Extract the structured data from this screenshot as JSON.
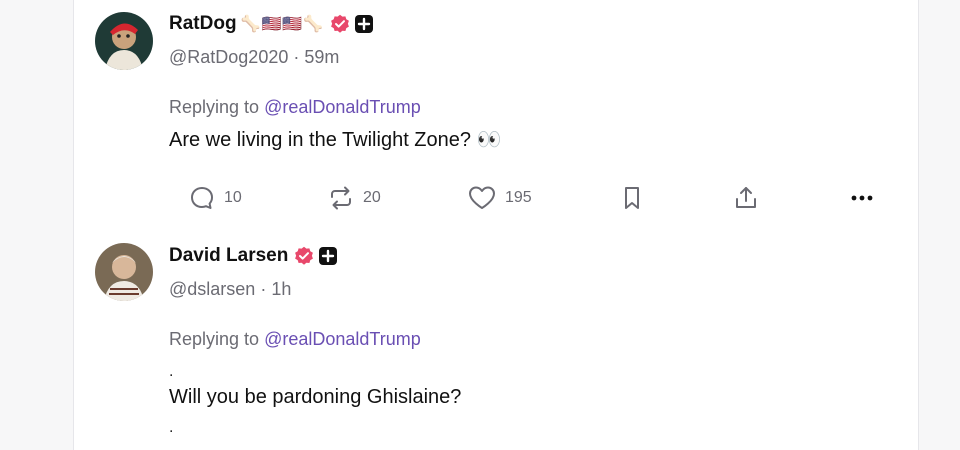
{
  "posts": [
    {
      "display_name": "RatDog",
      "name_emojis": "🦴🇺🇸🇺🇸🦴",
      "handle": "@RatDog2020",
      "time": "59m",
      "replying_prefix": "Replying to",
      "replying_mention": "@realDonaldTrump",
      "text": "Are we living in the Twilight Zone? 👀",
      "actions": {
        "replies": "10",
        "reposts": "20",
        "likes": "195"
      }
    },
    {
      "display_name": "David Larsen",
      "handle": "@dslarsen",
      "time": "1h",
      "replying_prefix": "Replying to",
      "replying_mention": "@realDonaldTrump",
      "text_dot_top": ".",
      "text": "Will you be pardoning Ghislaine?",
      "text_dot_bottom": "."
    }
  ],
  "colors": {
    "verified_badge": "#e8486b",
    "mention": "#6a4fb3",
    "muted": "#6b6b73",
    "plus_badge": "#111111"
  },
  "icons": {
    "reply": "reply-icon",
    "repost": "repost-icon",
    "like": "heart-icon",
    "bookmark": "bookmark-icon",
    "share": "share-icon",
    "more": "more-icon"
  }
}
